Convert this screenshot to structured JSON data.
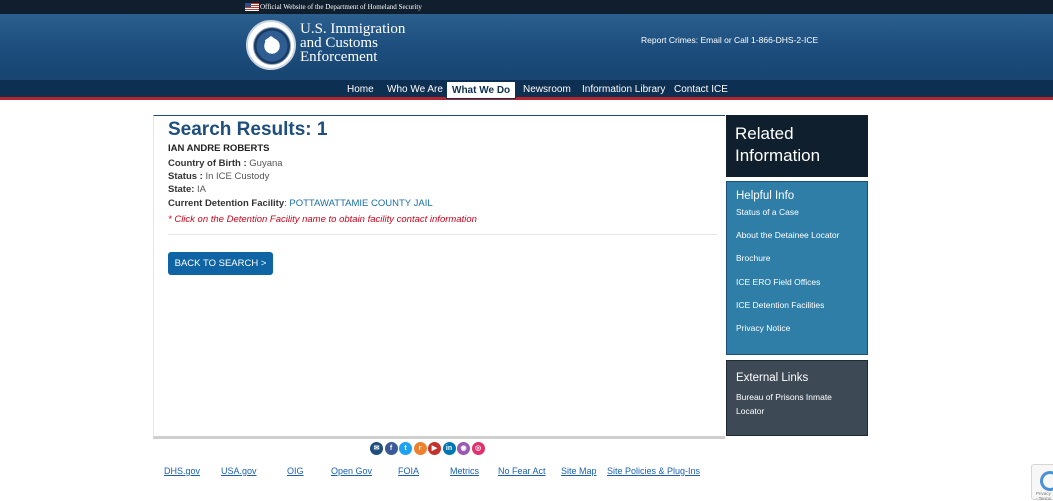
{
  "banner": {
    "text": "Official Website of the Department of Homeland Security"
  },
  "header": {
    "agency_line1": "U.S. Immigration",
    "agency_line2": "and Customs",
    "agency_line3": "Enforcement",
    "report": "Report Crimes: Email or Call 1-866-DHS-2-ICE"
  },
  "nav": {
    "items": [
      {
        "label": "Home"
      },
      {
        "label": "Who We Are"
      },
      {
        "label": "What We Do",
        "active": true
      },
      {
        "label": "Newsroom"
      },
      {
        "label": "Information Library"
      },
      {
        "label": "Contact ICE"
      }
    ]
  },
  "results": {
    "title": "Search Results: 1",
    "name": "IAN ANDRE ROBERTS",
    "country_label": "Country of Birth :",
    "country_value": "Guyana",
    "status_label": "Status :",
    "status_value": "In ICE Custody",
    "state_label": "State:",
    "state_value": "IA",
    "facility_label": "Current Detention Facility",
    "facility_sep": ":",
    "facility_value": "POTTAWATTAMIE COUNTY JAIL",
    "note": "* Click on the Detention Facility name to obtain facility contact information",
    "back_button": "BACK TO SEARCH >"
  },
  "sidebar": {
    "related_title_line1": "Related",
    "related_title_line2": "Information",
    "helpful_title": "Helpful Info",
    "helpful_links": [
      "Status of a Case",
      "About the Detainee Locator",
      "Brochure",
      "ICE ERO Field Offices",
      "ICE Detention Facilities",
      "Privacy Notice"
    ],
    "external_title": "External Links",
    "external_link_line1": "Bureau of Prisons Inmate",
    "external_link_line2": "Locator"
  },
  "social": {
    "icons": [
      {
        "name": "email-icon",
        "glyph": "✉",
        "color": "#1d4e7e"
      },
      {
        "name": "facebook-icon",
        "glyph": "f",
        "color": "#3b5998"
      },
      {
        "name": "twitter-icon",
        "glyph": "t",
        "color": "#1da1f2"
      },
      {
        "name": "rss-icon",
        "glyph": "r",
        "color": "#ee802f"
      },
      {
        "name": "youtube-icon",
        "glyph": "▶",
        "color": "#c4302b"
      },
      {
        "name": "linkedin-icon",
        "glyph": "in",
        "color": "#0077b5"
      },
      {
        "name": "podcast-icon",
        "glyph": "◉",
        "color": "#9b59b6"
      },
      {
        "name": "instagram-icon",
        "glyph": "◎",
        "color": "#e1306c"
      }
    ]
  },
  "footer": {
    "links": [
      "DHS.gov",
      "USA.gov",
      "OIG",
      "Open Gov",
      "FOIA",
      "Metrics",
      "No Fear Act",
      "Site Map",
      "Site Policies & Plug-Ins"
    ]
  },
  "captcha": {
    "text": "Privacy - Terms"
  }
}
